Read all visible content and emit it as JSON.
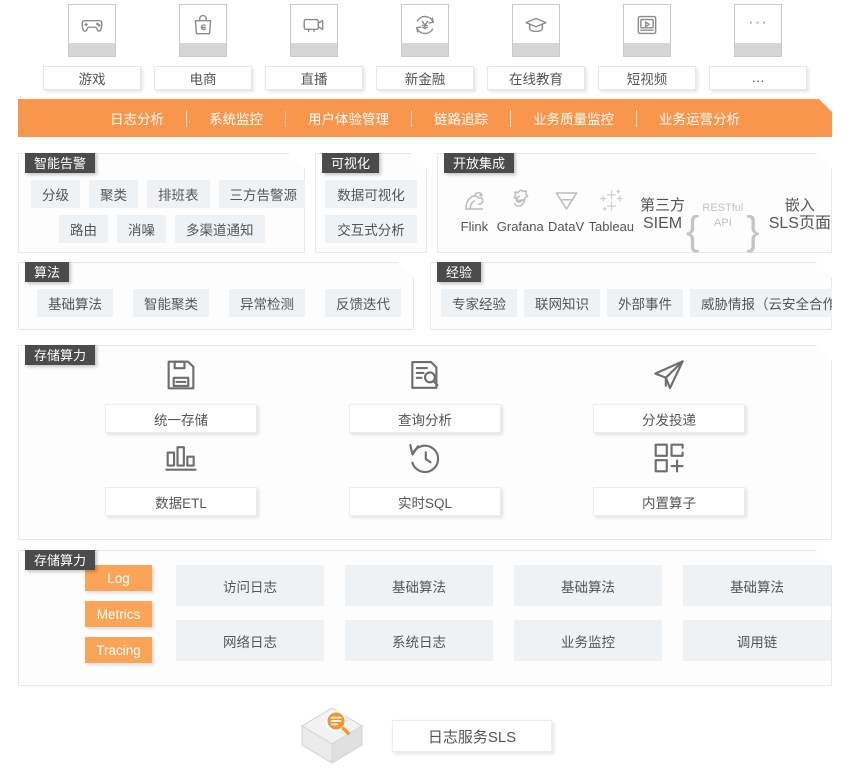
{
  "industries": [
    {
      "label": "游戏",
      "icon": "gamepad-icon"
    },
    {
      "label": "电商",
      "icon": "shopping-bag-icon"
    },
    {
      "label": "直播",
      "icon": "video-camera-icon"
    },
    {
      "label": "新金融",
      "icon": "yen-circle-icon"
    },
    {
      "label": "在线教育",
      "icon": "graduation-cap-icon"
    },
    {
      "label": "短视频",
      "icon": "video-play-icon"
    },
    {
      "label": "…",
      "icon": "ellipsis-icon"
    }
  ],
  "capability_bar": {
    "color": "#f8964c",
    "items": [
      "日志分析",
      "系统监控",
      "用户体验管理",
      "链路追踪",
      "业务质量监控",
      "业务运营分析"
    ]
  },
  "panels": {
    "smart_alert": {
      "title": "智能告警",
      "row1": [
        "分级",
        "聚类",
        "排班表",
        "三方告警源"
      ],
      "row2": [
        "路由",
        "消噪",
        "多渠道通知"
      ]
    },
    "visualization": {
      "title": "可视化",
      "items": [
        "数据可视化",
        "交互式分析"
      ]
    },
    "open_integration": {
      "title": "开放集成",
      "logos": [
        {
          "name": "Flink",
          "icon": "flink-squirrel-icon"
        },
        {
          "name": "Grafana",
          "icon": "grafana-icon"
        },
        {
          "name": "DataV",
          "icon": "datav-icon"
        },
        {
          "name": "Tableau",
          "icon": "tableau-icon"
        }
      ],
      "third_party": {
        "line1": "第三方",
        "line2": "SIEM"
      },
      "api": {
        "line1": "RESTful",
        "line2": "API"
      },
      "embed": {
        "line1": "嵌入",
        "line2": "SLS页面"
      }
    },
    "algorithm": {
      "title": "算法",
      "items": [
        "基础算法",
        "智能聚类",
        "异常检测",
        "反馈迭代"
      ]
    },
    "experience": {
      "title": "经验",
      "items": [
        "专家经验",
        "联网知识",
        "外部事件",
        "威胁情报（云安全合作）"
      ]
    },
    "storage_compute": {
      "title": "存储算力",
      "cells": [
        {
          "label": "统一存储",
          "icon": "save-disk-icon"
        },
        {
          "label": "查询分析",
          "icon": "document-search-icon"
        },
        {
          "label": "分发投递",
          "icon": "paper-plane-icon"
        },
        {
          "label": "数据ETL",
          "icon": "bar-chart-icon"
        },
        {
          "label": "实时SQL",
          "icon": "clock-rewind-icon"
        },
        {
          "label": "内置算子",
          "icon": "grid-plus-icon"
        }
      ]
    },
    "data_sources": {
      "title": "存储算力",
      "badge_color": "#f9a456",
      "badges": [
        "Log",
        "Metrics",
        "Tracing"
      ],
      "cells": [
        "访问日志",
        "基础算法",
        "基础算法",
        "基础算法",
        "网络日志",
        "系统日志",
        "业务监控",
        "调用链"
      ]
    }
  },
  "footer": {
    "logo_icon": "sls-cube-search-icon",
    "label": "日志服务SLS",
    "accent": "#f7922e"
  }
}
